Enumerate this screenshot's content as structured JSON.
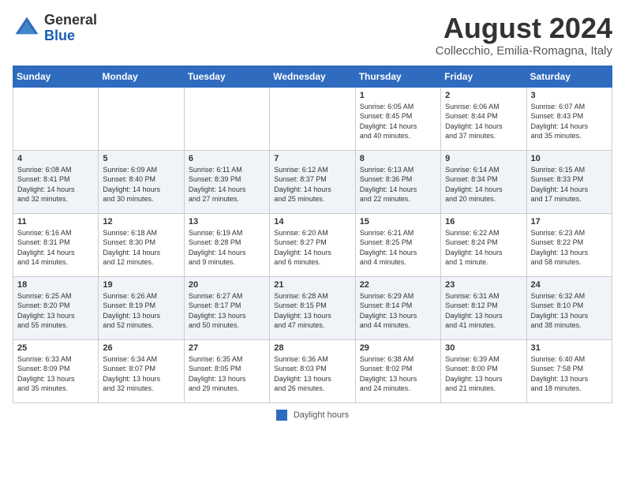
{
  "header": {
    "logo_general": "General",
    "logo_blue": "Blue",
    "month_title": "August 2024",
    "location": "Collecchio, Emilia-Romagna, Italy"
  },
  "weekdays": [
    "Sunday",
    "Monday",
    "Tuesday",
    "Wednesday",
    "Thursday",
    "Friday",
    "Saturday"
  ],
  "weeks": [
    [
      {
        "day": "",
        "content": ""
      },
      {
        "day": "",
        "content": ""
      },
      {
        "day": "",
        "content": ""
      },
      {
        "day": "",
        "content": ""
      },
      {
        "day": "1",
        "content": "Sunrise: 6:05 AM\nSunset: 8:45 PM\nDaylight: 14 hours\nand 40 minutes."
      },
      {
        "day": "2",
        "content": "Sunrise: 6:06 AM\nSunset: 8:44 PM\nDaylight: 14 hours\nand 37 minutes."
      },
      {
        "day": "3",
        "content": "Sunrise: 6:07 AM\nSunset: 8:43 PM\nDaylight: 14 hours\nand 35 minutes."
      }
    ],
    [
      {
        "day": "4",
        "content": "Sunrise: 6:08 AM\nSunset: 8:41 PM\nDaylight: 14 hours\nand 32 minutes."
      },
      {
        "day": "5",
        "content": "Sunrise: 6:09 AM\nSunset: 8:40 PM\nDaylight: 14 hours\nand 30 minutes."
      },
      {
        "day": "6",
        "content": "Sunrise: 6:11 AM\nSunset: 8:39 PM\nDaylight: 14 hours\nand 27 minutes."
      },
      {
        "day": "7",
        "content": "Sunrise: 6:12 AM\nSunset: 8:37 PM\nDaylight: 14 hours\nand 25 minutes."
      },
      {
        "day": "8",
        "content": "Sunrise: 6:13 AM\nSunset: 8:36 PM\nDaylight: 14 hours\nand 22 minutes."
      },
      {
        "day": "9",
        "content": "Sunrise: 6:14 AM\nSunset: 8:34 PM\nDaylight: 14 hours\nand 20 minutes."
      },
      {
        "day": "10",
        "content": "Sunrise: 6:15 AM\nSunset: 8:33 PM\nDaylight: 14 hours\nand 17 minutes."
      }
    ],
    [
      {
        "day": "11",
        "content": "Sunrise: 6:16 AM\nSunset: 8:31 PM\nDaylight: 14 hours\nand 14 minutes."
      },
      {
        "day": "12",
        "content": "Sunrise: 6:18 AM\nSunset: 8:30 PM\nDaylight: 14 hours\nand 12 minutes."
      },
      {
        "day": "13",
        "content": "Sunrise: 6:19 AM\nSunset: 8:28 PM\nDaylight: 14 hours\nand 9 minutes."
      },
      {
        "day": "14",
        "content": "Sunrise: 6:20 AM\nSunset: 8:27 PM\nDaylight: 14 hours\nand 6 minutes."
      },
      {
        "day": "15",
        "content": "Sunrise: 6:21 AM\nSunset: 8:25 PM\nDaylight: 14 hours\nand 4 minutes."
      },
      {
        "day": "16",
        "content": "Sunrise: 6:22 AM\nSunset: 8:24 PM\nDaylight: 14 hours\nand 1 minute."
      },
      {
        "day": "17",
        "content": "Sunrise: 6:23 AM\nSunset: 8:22 PM\nDaylight: 13 hours\nand 58 minutes."
      }
    ],
    [
      {
        "day": "18",
        "content": "Sunrise: 6:25 AM\nSunset: 8:20 PM\nDaylight: 13 hours\nand 55 minutes."
      },
      {
        "day": "19",
        "content": "Sunrise: 6:26 AM\nSunset: 8:19 PM\nDaylight: 13 hours\nand 52 minutes."
      },
      {
        "day": "20",
        "content": "Sunrise: 6:27 AM\nSunset: 8:17 PM\nDaylight: 13 hours\nand 50 minutes."
      },
      {
        "day": "21",
        "content": "Sunrise: 6:28 AM\nSunset: 8:15 PM\nDaylight: 13 hours\nand 47 minutes."
      },
      {
        "day": "22",
        "content": "Sunrise: 6:29 AM\nSunset: 8:14 PM\nDaylight: 13 hours\nand 44 minutes."
      },
      {
        "day": "23",
        "content": "Sunrise: 6:31 AM\nSunset: 8:12 PM\nDaylight: 13 hours\nand 41 minutes."
      },
      {
        "day": "24",
        "content": "Sunrise: 6:32 AM\nSunset: 8:10 PM\nDaylight: 13 hours\nand 38 minutes."
      }
    ],
    [
      {
        "day": "25",
        "content": "Sunrise: 6:33 AM\nSunset: 8:09 PM\nDaylight: 13 hours\nand 35 minutes."
      },
      {
        "day": "26",
        "content": "Sunrise: 6:34 AM\nSunset: 8:07 PM\nDaylight: 13 hours\nand 32 minutes."
      },
      {
        "day": "27",
        "content": "Sunrise: 6:35 AM\nSunset: 8:05 PM\nDaylight: 13 hours\nand 29 minutes."
      },
      {
        "day": "28",
        "content": "Sunrise: 6:36 AM\nSunset: 8:03 PM\nDaylight: 13 hours\nand 26 minutes."
      },
      {
        "day": "29",
        "content": "Sunrise: 6:38 AM\nSunset: 8:02 PM\nDaylight: 13 hours\nand 24 minutes."
      },
      {
        "day": "30",
        "content": "Sunrise: 6:39 AM\nSunset: 8:00 PM\nDaylight: 13 hours\nand 21 minutes."
      },
      {
        "day": "31",
        "content": "Sunrise: 6:40 AM\nSunset: 7:58 PM\nDaylight: 13 hours\nand 18 minutes."
      }
    ]
  ],
  "footer": {
    "legend_label": "Daylight hours"
  }
}
